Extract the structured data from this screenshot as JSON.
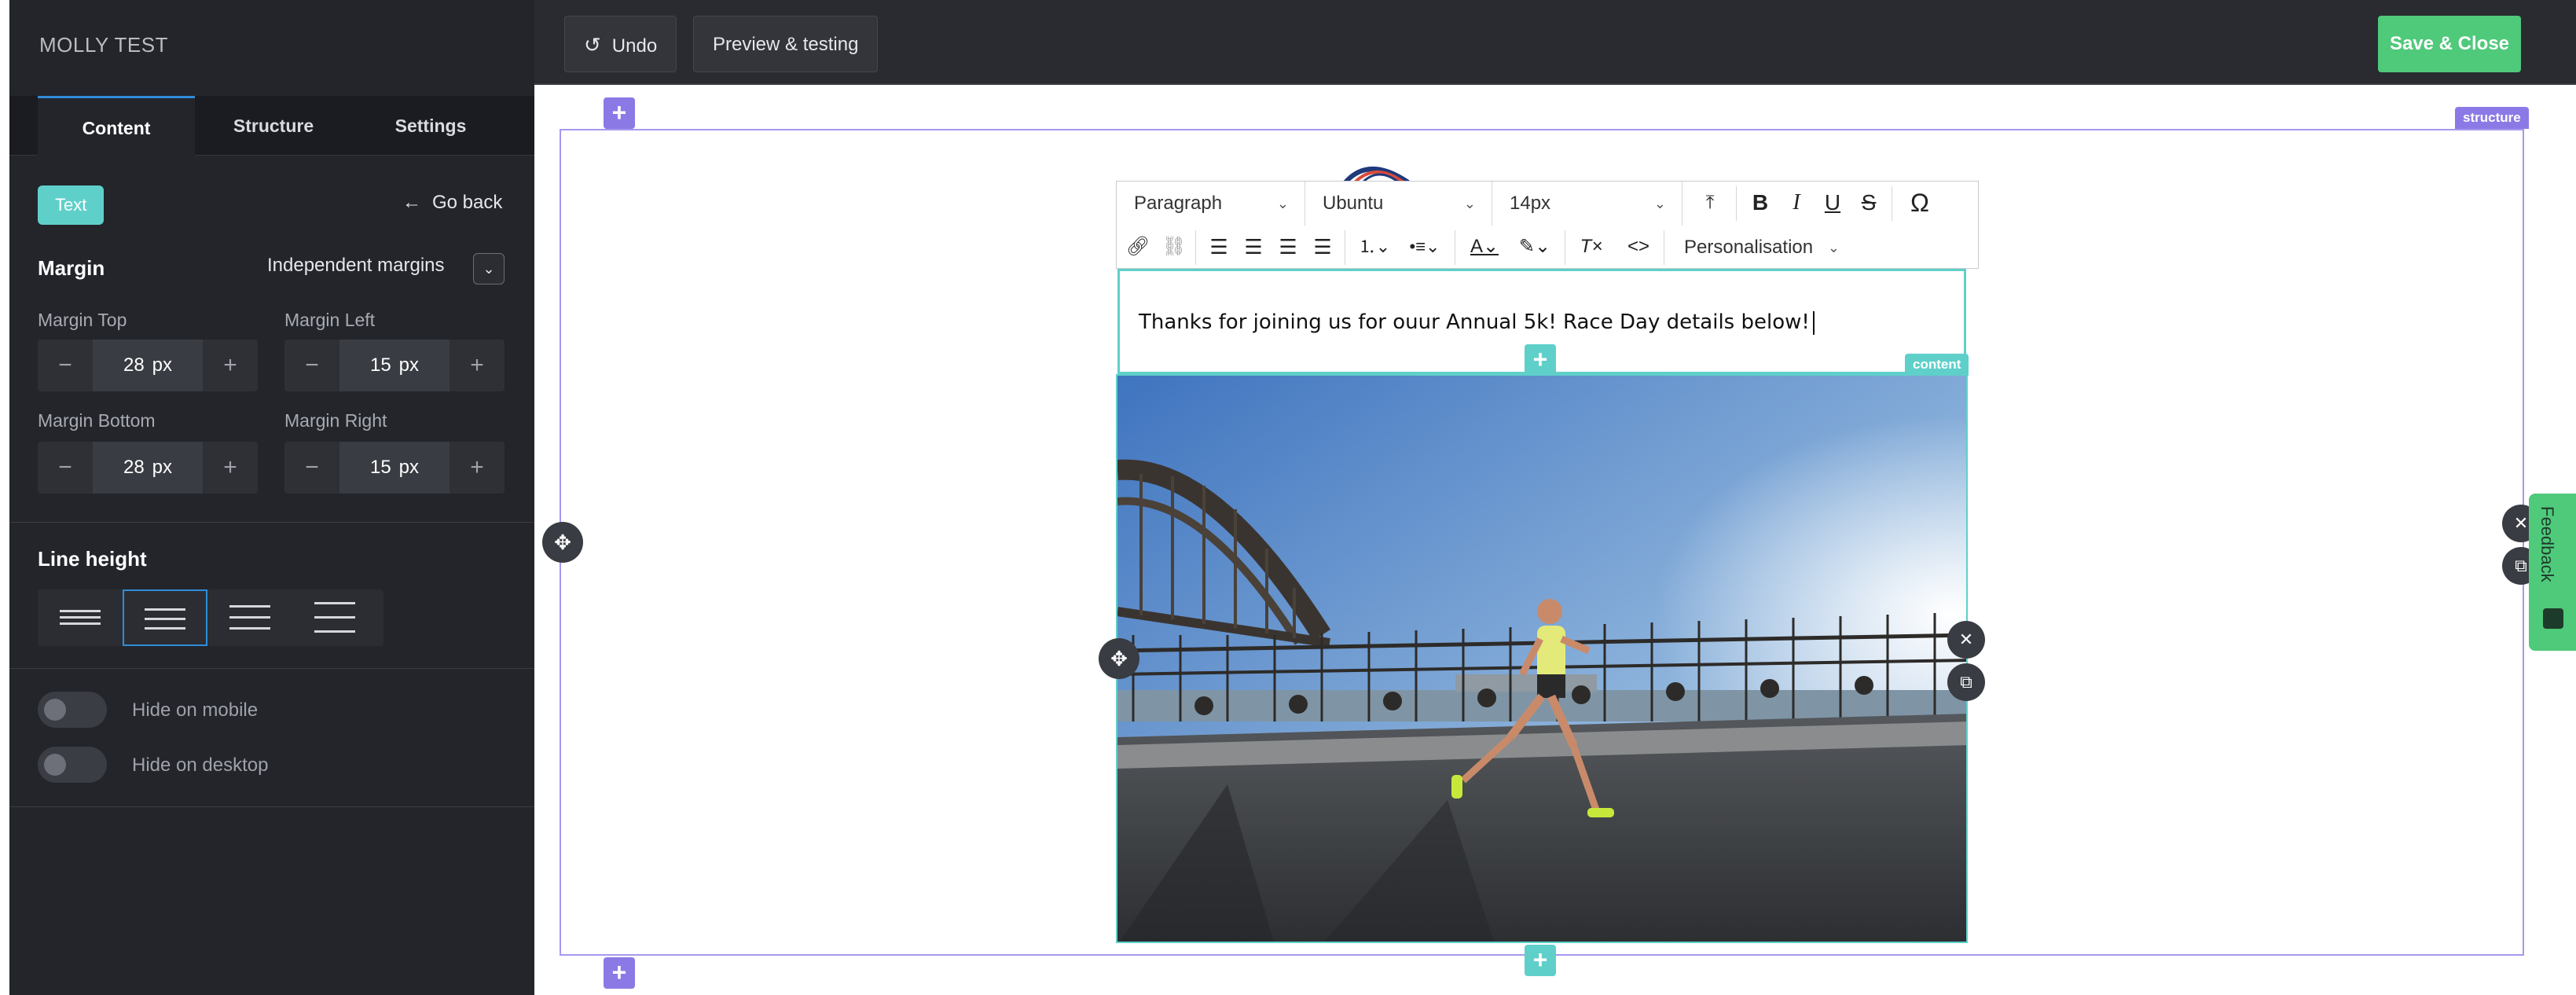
{
  "sidebar": {
    "title": "MOLLY TEST",
    "tabs": [
      "Content",
      "Structure",
      "Settings"
    ],
    "block_badge": "Text",
    "go_back": "Go back",
    "margin_heading": "Margin",
    "independent_margins": "Independent margins",
    "fields": {
      "top": {
        "label": "Margin Top",
        "value": "28",
        "unit": "px"
      },
      "left": {
        "label": "Margin Left",
        "value": "15",
        "unit": "px"
      },
      "bottom": {
        "label": "Margin Bottom",
        "value": "28",
        "unit": "px"
      },
      "right": {
        "label": "Margin Right",
        "value": "15",
        "unit": "px"
      }
    },
    "line_height_heading": "Line height",
    "hide_mobile": "Hide on mobile",
    "hide_desktop": "Hide on desktop"
  },
  "topbar": {
    "undo": "Undo",
    "preview": "Preview & testing",
    "save": "Save & Close"
  },
  "editor": {
    "format": "Paragraph",
    "font": "Ubuntu",
    "size": "14px",
    "personalisation": "Personalisation",
    "content_text": "Thanks for joining us for ouur Annual 5k! Race Day details below!"
  },
  "tags": {
    "structure": "structure",
    "content": "content"
  },
  "feedback": "Feedback",
  "colors": {
    "accent_purple": "#8b7ae6",
    "accent_teal": "#5fd0c9",
    "save_green": "#4fc97a",
    "sidebar_bg": "#23252b"
  }
}
